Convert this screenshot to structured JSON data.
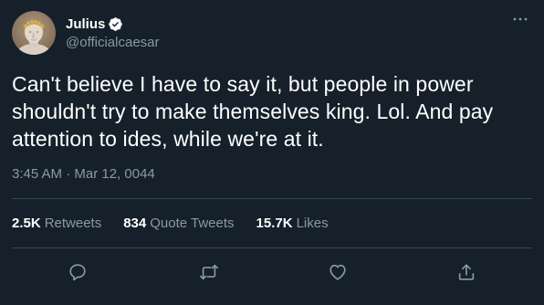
{
  "tweet": {
    "display_name": "Julius",
    "handle": "@officialcaesar",
    "verified_icon": "verified-badge-icon",
    "text": "Can't believe I have to say it, but people in power shouldn't try to make themselves king. Lol. And pay attention to ides, while we're at it.",
    "timestamp": "3:45 AM · Mar 12, 0044"
  },
  "stats": {
    "retweets_count": "2.5K",
    "retweets_label": "Retweets",
    "quotes_count": "834",
    "quotes_label": "Quote Tweets",
    "likes_count": "15.7K",
    "likes_label": "Likes"
  },
  "actions": [
    "reply-icon",
    "retweet-icon",
    "like-icon",
    "share-icon"
  ],
  "colors": {
    "background": "#15202b",
    "text": "#ffffff",
    "muted": "#8b98a5",
    "divider": "#38444d"
  }
}
